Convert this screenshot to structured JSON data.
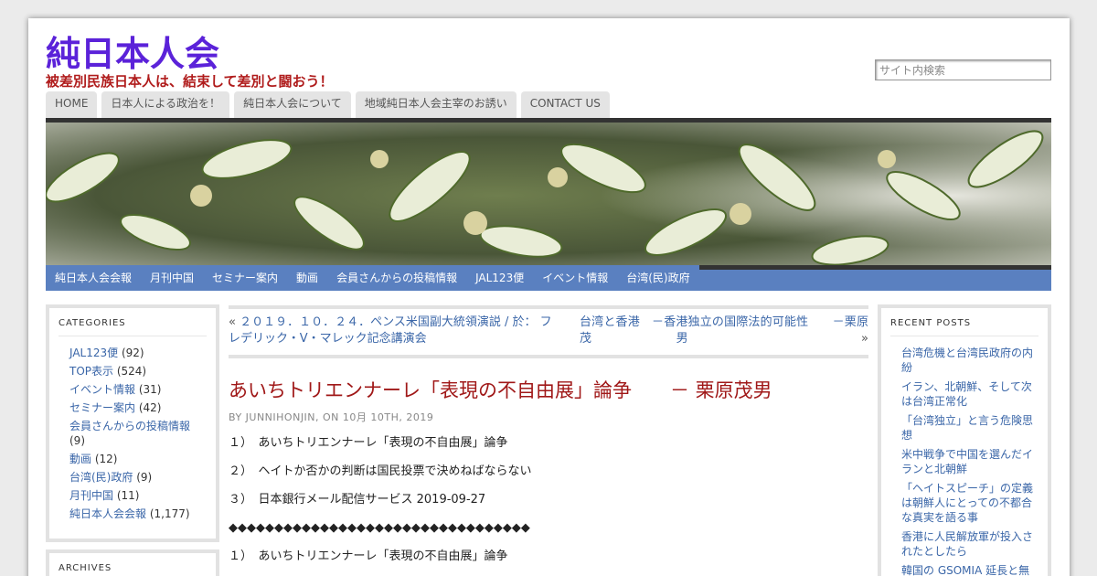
{
  "site": {
    "title": "純日本人会",
    "description": "被差別民族日本人は、結束して差別と闘おう！"
  },
  "search": {
    "placeholder": "サイト内検索"
  },
  "top_nav": [
    "HOME",
    "日本人による政治を！",
    "純日本人会について",
    "地域純日本人会主宰のお誘い",
    "CONTACT US"
  ],
  "cat_nav": [
    "純日本人会会報",
    "月刊中国",
    "セミナー案内",
    "動画",
    "会員さんからの投稿情報",
    "JAL123便",
    "イベント情報",
    "台湾(民)政府"
  ],
  "categories": {
    "title": "CATEGORIES",
    "items": [
      {
        "label": "JAL123便",
        "count": "(92)"
      },
      {
        "label": "TOP表示",
        "count": "(524)"
      },
      {
        "label": "イベント情報",
        "count": "(31)"
      },
      {
        "label": "セミナー案内",
        "count": "(42)"
      },
      {
        "label": "会員さんからの投稿情報",
        "count": "(9)"
      },
      {
        "label": "動画",
        "count": "(12)"
      },
      {
        "label": "台湾(民)政府",
        "count": "(9)"
      },
      {
        "label": "月刊中国",
        "count": "(11)"
      },
      {
        "label": "純日本人会会報",
        "count": "(1,177)"
      }
    ]
  },
  "archives": {
    "title": "ARCHIVES"
  },
  "recent_posts": {
    "title": "RECENT POSTS",
    "items": [
      "台湾危機と台湾民政府の内紛",
      "イラン、北朝鮮、そして次は台湾正常化",
      "「台湾独立」と言う危険思想",
      "米中戦争で中国を選んだイランと北朝鮮",
      "「ヘイトスピーチ」の定義は朝鮮人にとっての不都合な真実を語る事",
      "香港に人民解放軍が投入されたとしたら",
      "韓国の GSOMIA 延長と無"
    ]
  },
  "post_nav": {
    "prev_arrow": "«",
    "prev_label": "２０１９．１０．２４．ペンス米国副大統領演説 / 於： フレデリック・V・マレック記念講演会",
    "next_label": "台湾と香港　－香港独立の国際法的可能性　　－栗原茂男",
    "next_arrow": "»"
  },
  "post": {
    "title": "あいちトリエンナーレ「表現の不自由展」論争　　－ 栗原茂男",
    "meta": "BY JUNNIHONJIN, ON 10月 10TH, 2019",
    "lines": [
      "１）　あいちトリエンナーレ「表現の不自由展」論争",
      "２）　ヘイトか否かの判断は国民投票で決めねばならない",
      "３）　日本銀行メール配信サービス 2019-09-27",
      "◆◆◆◆◆◆◆◆◆◆◆◆◆◆◆◆◆◆◆◆◆◆◆◆◆◆◆◆◆◆◆◆◆",
      "１）　あいちトリエンナーレ「表現の不自由展」論争"
    ]
  },
  "colors": {
    "title": "#5b22d9",
    "tagline": "#b01c1c",
    "link": "#3a66a8",
    "post_title": "#a01818",
    "cat_nav_bg": "#5a80c0",
    "bar": "#333333"
  }
}
